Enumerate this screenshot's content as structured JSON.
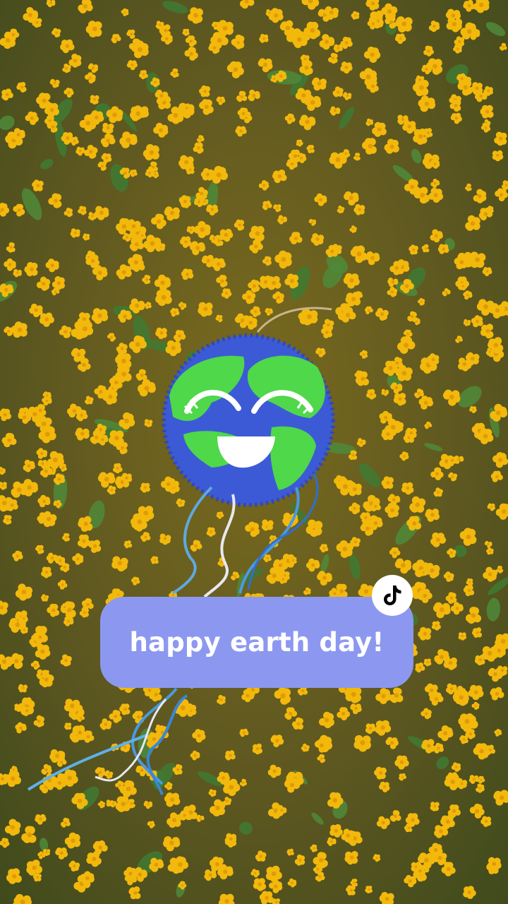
{
  "caption": {
    "text": "happy earth day!",
    "card_color": "#8c98f0",
    "text_color": "#ffffff"
  },
  "badge": {
    "icon": "tiktok-logo-icon"
  },
  "scene": {
    "flower_color": "#f2b90c",
    "ground_color": "#5a5a22",
    "pinata_ocean": "#3d5ad6",
    "pinata_land": "#4ed84a"
  }
}
